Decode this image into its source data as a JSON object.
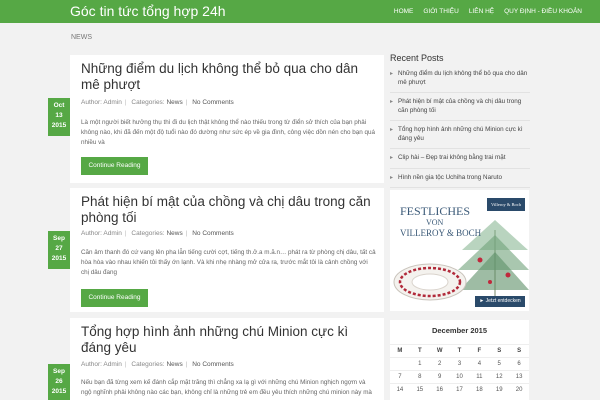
{
  "site": {
    "title": "Góc tin tức tổng hợp 24h"
  },
  "nav": [
    "HOME",
    "GIỚI THIỆU",
    "LIÊN HỆ",
    "QUY ĐỊNH - ĐIỀU KHOẢN"
  ],
  "breadcrumb": "NEWS",
  "posts": [
    {
      "title": "Những điểm du lịch không thể bỏ qua cho dân mê phượt",
      "date": {
        "month": "Oct",
        "day": "13",
        "year": "2015"
      },
      "author_label": "Author:",
      "author": "Admin",
      "category_label": "Categories:",
      "category": "News",
      "comments": "No Comments",
      "excerpt": "Là một người biết hưởng thụ thì đi du lịch thật không thể nào thiếu trong từ điển sở thích của bạn phải không nào, khi đã đến một độ tuổi nào đó dường như sức ép về gia đình, công việc dồn nén cho bạn quá nhiều và",
      "button": "Continue Reading"
    },
    {
      "title": "Phát hiện bí mật của chồng và chị dâu trong căn phòng tối",
      "date": {
        "month": "Sep",
        "day": "27",
        "year": "2015"
      },
      "author_label": "Author:",
      "author": "Admin",
      "category_label": "Categories:",
      "category": "News",
      "comments": "No Comments",
      "excerpt": "Căn âm thanh đó cứ vang lên pha lẫn tiếng cười cợt, tiếng th.ở.a m.ă.n… phát ra từ phòng chị dâu, tất cả hòa hòa vào nhau khiến tôi thấy ớn lạnh. Và khi nhẹ nhàng mở cửa ra, trước mắt tôi là cảnh chồng với chị dâu đang",
      "button": "Continue Reading"
    },
    {
      "title": "Tổng hợp hình ảnh những chú Minion cực kì đáng yêu",
      "date": {
        "month": "Sep",
        "day": "26",
        "year": "2015"
      },
      "author_label": "Author:",
      "author": "Admin",
      "category_label": "Categories:",
      "category": "News",
      "comments": "No Comments",
      "excerpt": "Nếu bạn đã từng xem kế đánh cắp mặt trăng thì chẳng xa lạ gì với những chú Minion nghịch ngợm và ngộ nghĩnh phải không nào các bạn, không chỉ là những trẻ em đều yêu thích những chú minion này mà"
    }
  ],
  "sidebar": {
    "recent_title": "Recent Posts",
    "recent_posts": [
      "Những điểm du lịch không thể bỏ qua cho dân mê phượt",
      "Phát hiện bí mật của chồng và chị dâu trong căn phòng tối",
      "Tổng hợp hình ảnh những chú Minion cực kì đáng yêu",
      "Clip hài – Đẹp trai không bằng trai mặt",
      "Hình nền gia tộc Uchiha trong Naruto"
    ],
    "ad": {
      "headline": "FESTLICHES",
      "sub1": "VON",
      "sub2": "VILLEROY & BOCH",
      "brand": "Villeroy & Boch",
      "cta": "► Jetzt entdecken"
    },
    "calendar": {
      "title": "December 2015",
      "weekdays": [
        "M",
        "T",
        "W",
        "T",
        "F",
        "S",
        "S"
      ],
      "rows": [
        [
          "",
          "1",
          "2",
          "3",
          "4",
          "5",
          "6"
        ],
        [
          "7",
          "8",
          "9",
          "10",
          "11",
          "12",
          "13"
        ],
        [
          "14",
          "15",
          "16",
          "17",
          "18",
          "19",
          "20"
        ]
      ]
    }
  },
  "colors": {
    "accent": "#56a845",
    "background": "#f2f2f2"
  }
}
